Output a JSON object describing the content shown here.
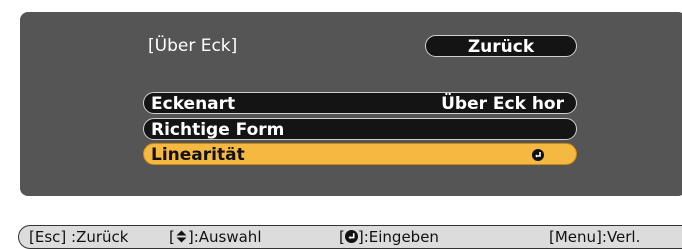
{
  "menu": {
    "title": "[Über Eck]",
    "back_label": "Zurück",
    "items": [
      {
        "label": "Eckenart",
        "value": "Über Eck hor"
      },
      {
        "label": "Richtige Form",
        "value": ""
      },
      {
        "label": "Linearität",
        "value_icon": "enter-icon",
        "selected": true
      }
    ]
  },
  "status_bar": {
    "esc_hint": "[Esc] :Zurück",
    "select_hint_prefix": "[",
    "select_hint_suffix": "]:Auswahl",
    "select_icon": "up-down-arrows-icon",
    "enter_hint_prefix": "[",
    "enter_hint_suffix": "]:Eingeben",
    "enter_icon": "enter-icon",
    "menu_hint": "[Menu]:Verl."
  },
  "colors": {
    "panel": "#555555",
    "item_bg": "#141414",
    "selected_bg": "#f5b840",
    "status_bg": "#dcdcdc"
  }
}
